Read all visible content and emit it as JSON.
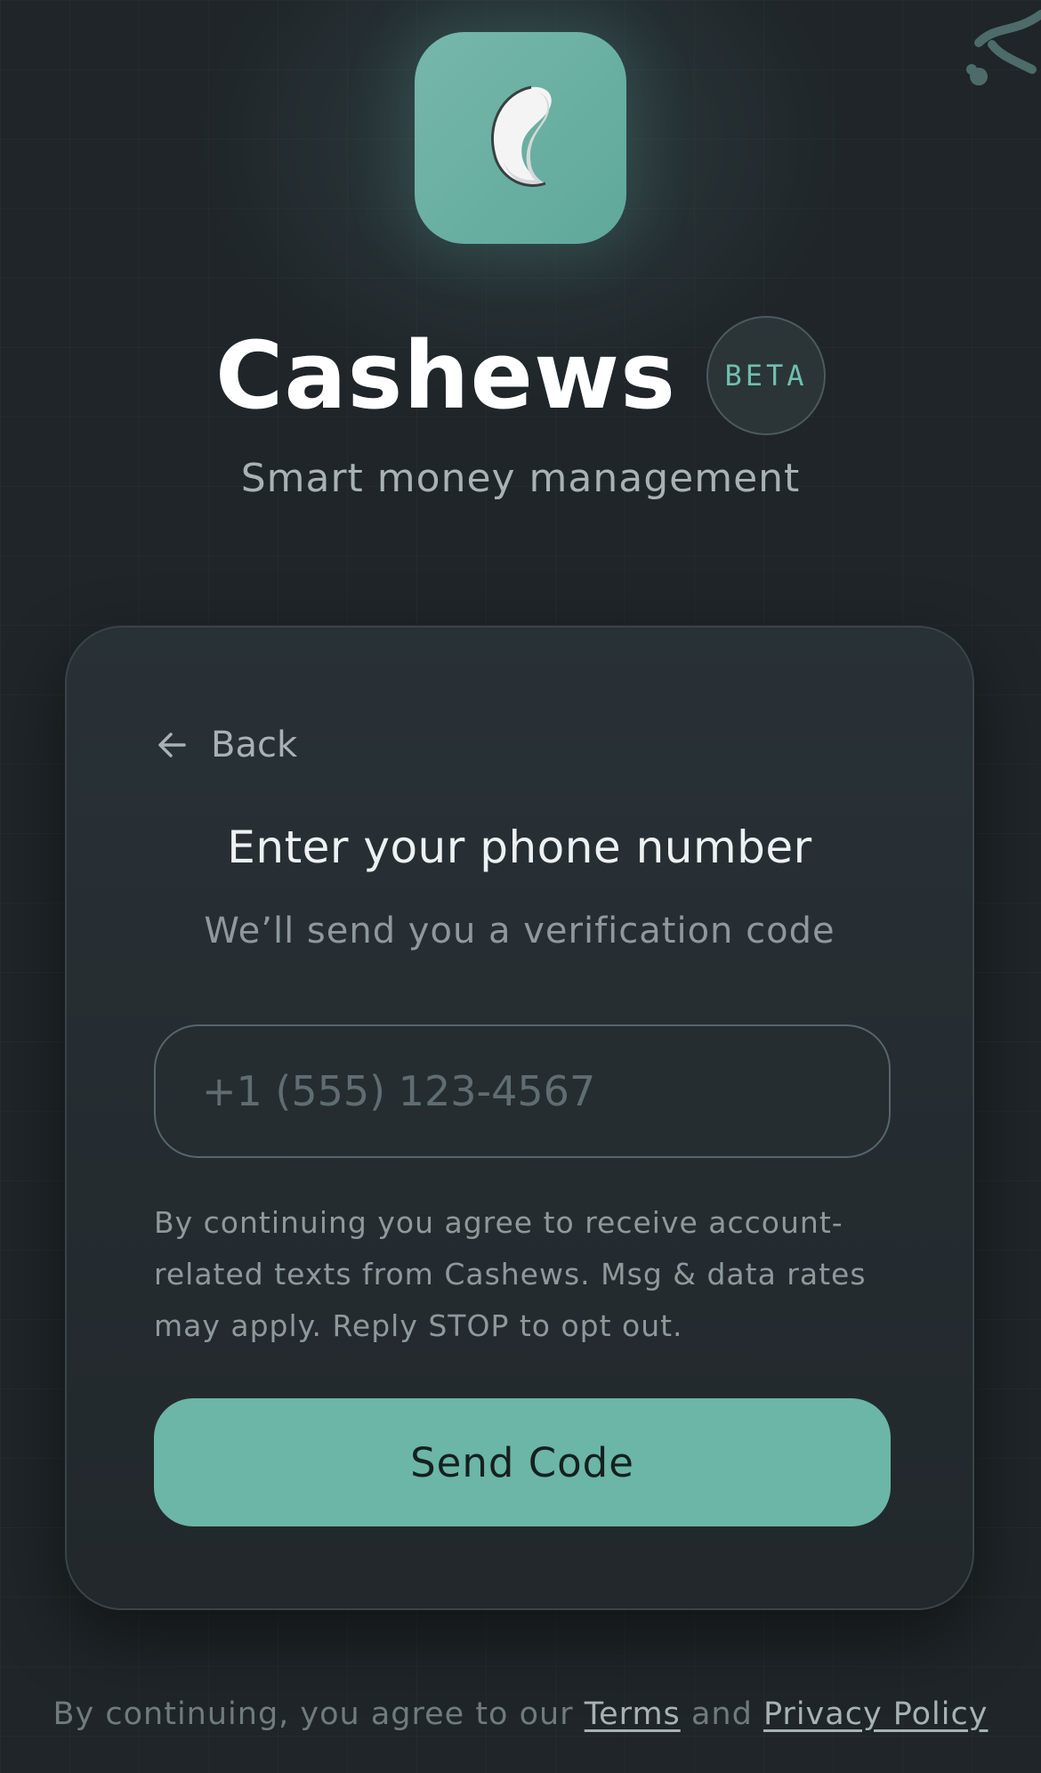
{
  "brand": {
    "name": "Cashews",
    "badge": "BETA",
    "tagline": "Smart money management",
    "logo_icon": "cashew-logo-icon",
    "accent_color": "#6bb6a7"
  },
  "card": {
    "back_label": "Back",
    "back_icon": "arrow-left-icon",
    "title": "Enter your phone number",
    "subtitle": "We’ll send you a verification code",
    "phone_input": {
      "value": "",
      "placeholder": "+1 (555) 123-4567"
    },
    "disclaimer": "By continuing you agree to receive account-related texts from Cashews. Msg & data rates may apply. Reply STOP to opt out.",
    "submit_label": "Send Code"
  },
  "footer": {
    "prefix": "By continuing, you agree to our",
    "terms_label": "Terms",
    "conjunction": "and",
    "privacy_label": "Privacy Policy"
  }
}
